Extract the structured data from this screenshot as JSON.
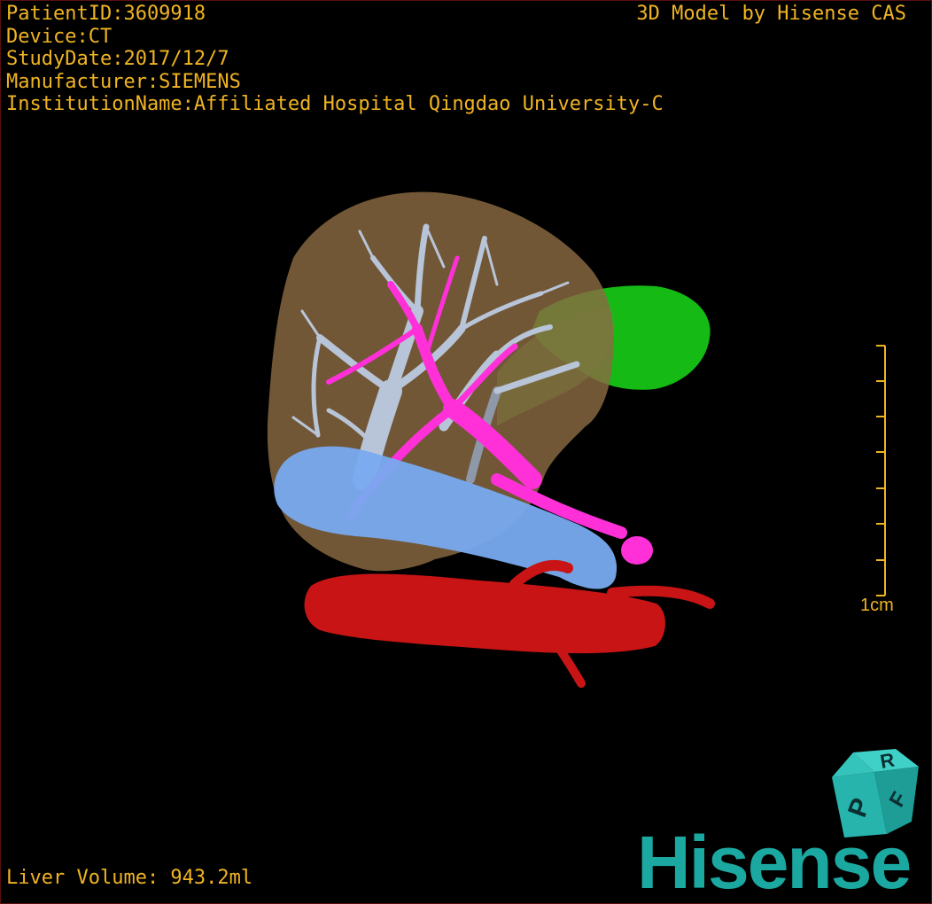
{
  "overlay": {
    "patient_id": "PatientID:3609918",
    "device": "Device:CT",
    "study_date": "StudyDate:2017/12/7",
    "manufacturer": "Manufacturer:SIEMENS",
    "institution": "InstitutionName:Affiliated Hospital Qingdao University-C",
    "credit": "3D Model by Hisense CAS",
    "liver_volume": "Liver Volume:  943.2ml"
  },
  "scale_bar": {
    "label": "1cm"
  },
  "orientation_cube": {
    "top_face": "R",
    "front_face": "P",
    "side_face": "F"
  },
  "brand": {
    "logo_text": "Hisense"
  },
  "colors": {
    "overlay_text": "#f0b423",
    "liver": "#8a6a42",
    "hepatic_vein": "#b8c4d8",
    "portal_vein": "#ff30d8",
    "ivc": "#78aaf0",
    "aorta": "#c81414",
    "spleen_green": "#18c818",
    "brand_teal": "#1aa8a0"
  }
}
